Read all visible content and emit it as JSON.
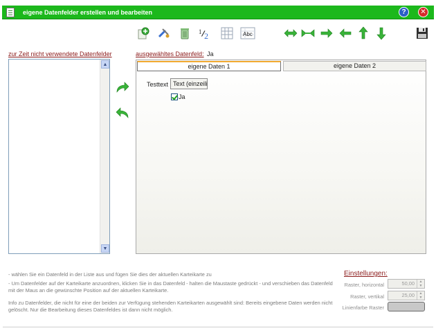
{
  "window": {
    "title": "eigene Datenfelder erstellen und bearbeiten",
    "help_label": "?",
    "close_label": "✕"
  },
  "toolbar": {
    "new_field_icon": "add-field-icon",
    "edit_icon": "edit-tools-icon",
    "delete_icon": "trash-icon",
    "number_icon_text_small": "1",
    "number_icon_text_large": "2",
    "table_icon": "grid-table-icon",
    "text_icon_label": "Abc",
    "save_icon": "floppy-disk-icon",
    "accent_color": "#39b339"
  },
  "left_panel": {
    "heading": "zur Zeit nicht verwendete Datenfelder",
    "items": []
  },
  "right_panel": {
    "selected_label": "ausgewähltes Datenfeld:",
    "selected_value": "Ja",
    "tabs": [
      {
        "label": "eigene Daten 1",
        "active": true
      },
      {
        "label": "eigene Daten 2",
        "active": false
      }
    ],
    "fields": {
      "text_label": "Testtext",
      "text_value": "Text (einzeili",
      "checkbox_label": "Ja",
      "checkbox_checked": true
    }
  },
  "info": {
    "line1": "- wählen Sie ein Datenfeld in der Liste aus und fügen Sie dies der aktuellen Karteikarte zu",
    "line2": "- Um Datenfelder auf der Karteikarte anzuordnen, klicken Sie in das Datenfeld - halten die Maustaste gedrückt - und verschieben das Datenfeld mit der Maus an die gewünschte Position auf der aktuellen Karteikarte.",
    "line3": "Info zu Datenfelder, die nicht für eine der beiden zur Verfügung stehenden Karteikarten ausgewählt sind: Bereits eingebene Daten werden nicht gelöscht. Nur die Bearbeitung dieses Datenfeldes ist  dann nicht möglich."
  },
  "settings": {
    "title": "Einstellungen:",
    "raster_h_label": "Raster, horizontal",
    "raster_h_value": "50,00",
    "raster_v_label": "Raster, vertikal",
    "raster_v_value": "25,00",
    "line_color_label": "Linienfarbe Raster",
    "line_color": "#c8c8c8"
  }
}
